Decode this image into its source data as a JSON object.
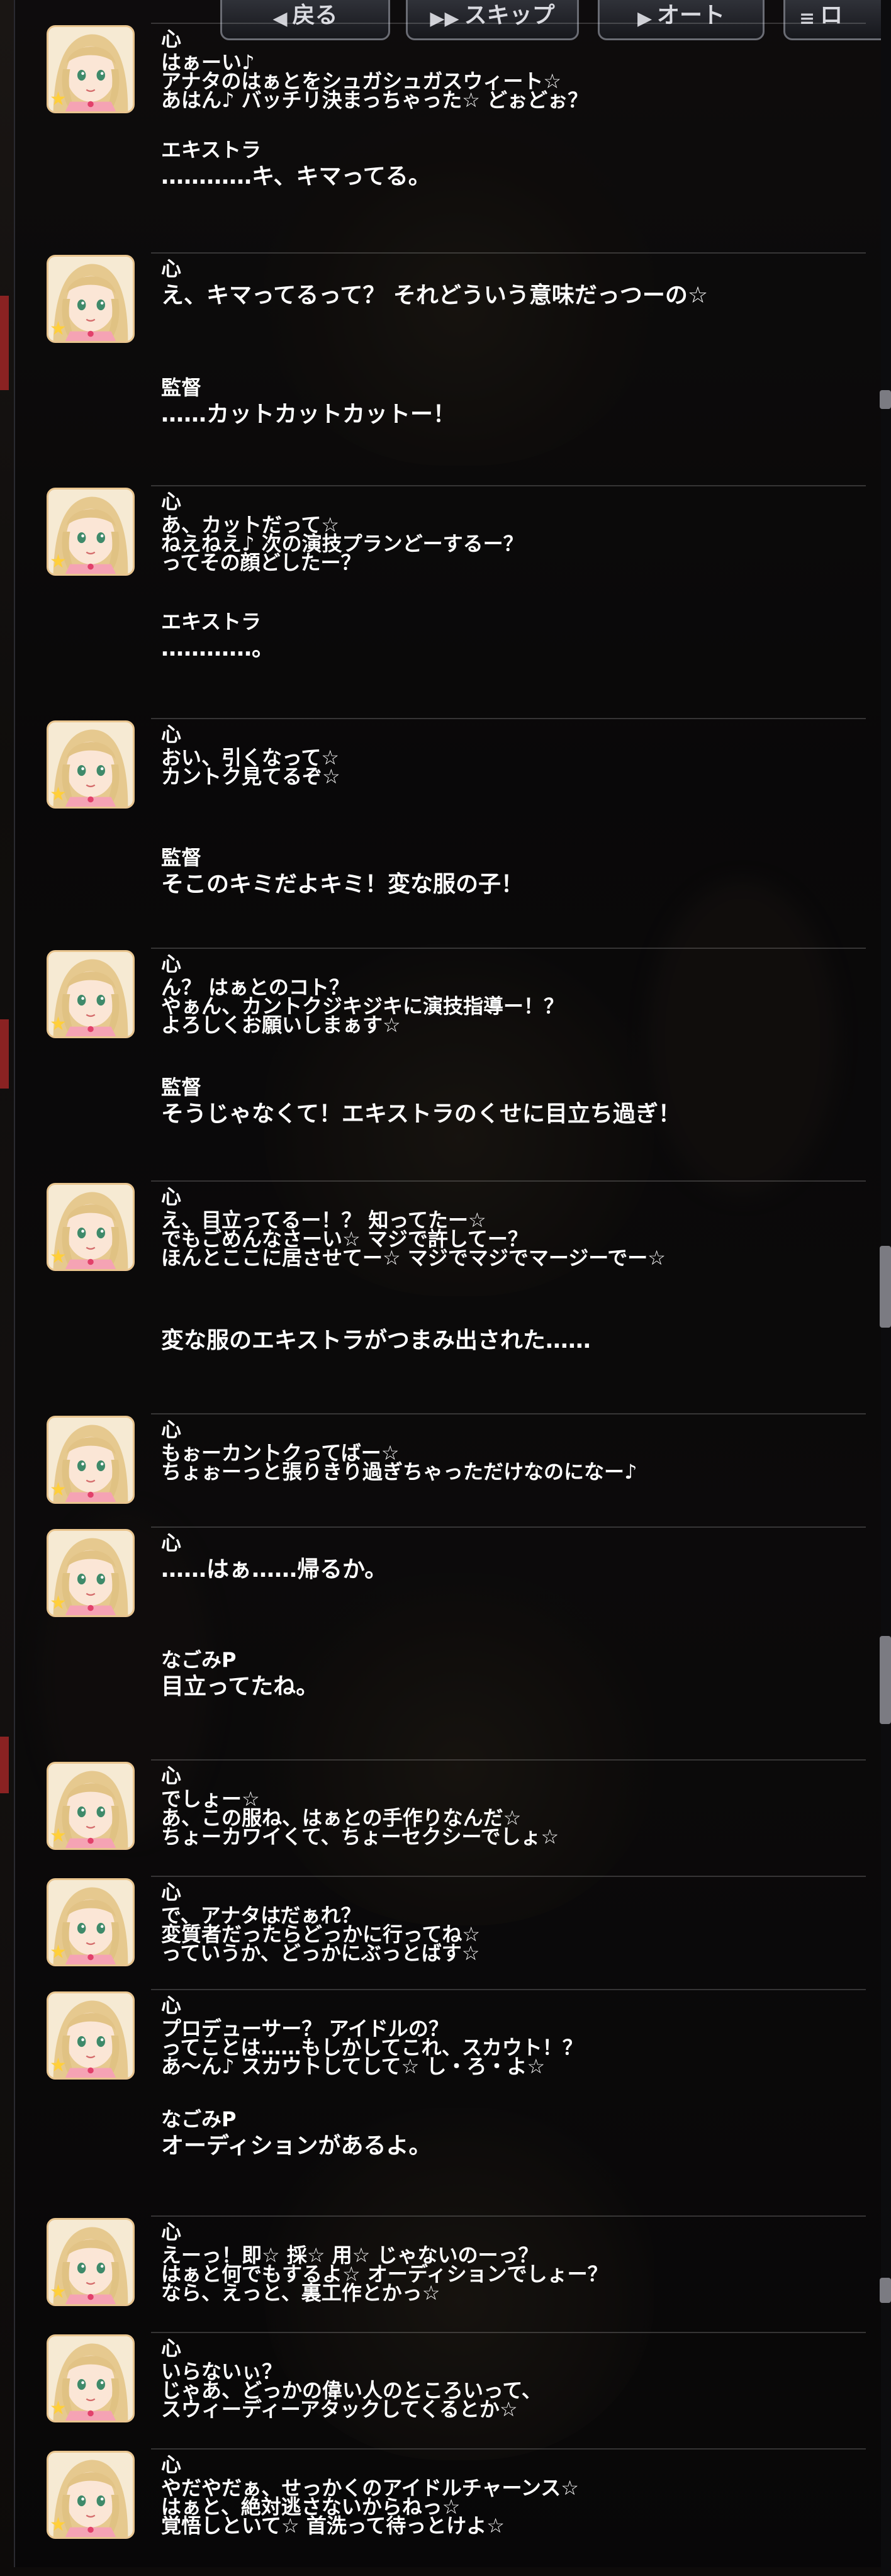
{
  "menu": {
    "buttons": [
      {
        "label": "戻る",
        "icon": "back-icon",
        "glyph": "◀"
      },
      {
        "label": "スキップ",
        "icon": "skip-icon",
        "glyph": "▶▶"
      },
      {
        "label": "オート",
        "icon": "auto-icon",
        "glyph": "▶"
      },
      {
        "label": "ロ",
        "icon": "menu-icon",
        "glyph": "≡"
      }
    ]
  },
  "colors": {
    "accent_avatar_border": "#e9c58f",
    "star": "#ffcf3a",
    "text": "#ffffff"
  },
  "log": [
    {
      "speaker": "心",
      "avatar": true,
      "lines": [
        "はぁーい♪",
        "アナタのはぁとをシュガシュガスウィート☆",
        "あはん♪ バッチリ決まっちゃった☆ どぉどぉ？"
      ]
    },
    {
      "speaker": "エキストラ",
      "avatar": false,
      "lines": [
        "…………キ、キマってる。"
      ]
    },
    {
      "speaker": "心",
      "avatar": true,
      "lines": [
        "え、キマってるって？ それどういう意味だっつーの☆"
      ]
    },
    {
      "speaker": "監督",
      "avatar": false,
      "lines": [
        "……カットカットカットー！"
      ]
    },
    {
      "speaker": "心",
      "avatar": true,
      "lines": [
        "あ、カットだって☆",
        "ねえねえ♪ 次の演技プランどーするー？",
        "ってその顔どしたー？"
      ]
    },
    {
      "speaker": "エキストラ",
      "avatar": false,
      "lines": [
        "…………。"
      ]
    },
    {
      "speaker": "心",
      "avatar": true,
      "lines": [
        "おい、引くなって☆",
        "カントク見てるぞ☆"
      ]
    },
    {
      "speaker": "監督",
      "avatar": false,
      "lines": [
        "そこのキミだよキミ！変な服の子！"
      ]
    },
    {
      "speaker": "心",
      "avatar": true,
      "lines": [
        "ん？ はぁとのコト？",
        "やぁん、カントクジキジキに演技指導ー！？",
        "よろしくお願いしまぁす☆"
      ]
    },
    {
      "speaker": "監督",
      "avatar": false,
      "lines": [
        "そうじゃなくて！エキストラのくせに目立ち過ぎ！"
      ]
    },
    {
      "speaker": "心",
      "avatar": true,
      "lines": [
        "え、目立ってるー！？ 知ってたー☆",
        "でもごめんなさーい☆ マジで許してー？",
        "ほんとここに居させてー☆ マジでマジでマージーでー☆"
      ]
    },
    {
      "speaker": "",
      "avatar": false,
      "lines": [
        "変な服のエキストラがつまみ出された……"
      ]
    },
    {
      "speaker": "心",
      "avatar": true,
      "lines": [
        "もぉーカントクってばー☆",
        "ちょぉーっと張りきり過ぎちゃっただけなのになー♪"
      ]
    },
    {
      "speaker": "心",
      "avatar": true,
      "lines": [
        "……はぁ……帰るか。"
      ]
    },
    {
      "speaker": "なごみP",
      "avatar": false,
      "lines": [
        "目立ってたね。"
      ]
    },
    {
      "speaker": "心",
      "avatar": true,
      "lines": [
        "でしょー☆",
        "あ、この服ね、はぁとの手作りなんだ☆",
        "ちょーカワイくて、ちょーセクシーでしょ☆"
      ]
    },
    {
      "speaker": "心",
      "avatar": true,
      "lines": [
        "で、アナタはだぁれ？",
        "変質者だったらどっかに行ってね☆",
        "っていうか、どっかにぶっとばす☆"
      ]
    },
    {
      "speaker": "心",
      "avatar": true,
      "lines": [
        "プロデューサー？ アイドルの？",
        "ってことは……もしかしてこれ、スカウト！？",
        "あ～ん♪ スカウトしてして☆ し・ろ・よ☆"
      ]
    },
    {
      "speaker": "なごみP",
      "avatar": false,
      "lines": [
        "オーディションがあるよ。"
      ]
    },
    {
      "speaker": "心",
      "avatar": true,
      "lines": [
        "えーっ！即☆ 採☆ 用☆ じゃないのーっ？",
        "はぁと何でもするよ☆ オーディションでしょー？",
        "なら、えっと、裏工作とかっ☆"
      ]
    },
    {
      "speaker": "心",
      "avatar": true,
      "lines": [
        "いらないぃ？",
        "じゃあ、どっかの偉い人のところいって、",
        "スウィーディーアタックしてくるとか☆"
      ]
    },
    {
      "speaker": "心",
      "avatar": true,
      "lines": [
        "やだやだぁ、せっかくのアイドルチャーンス☆",
        "はぁと、絶対逃さないからねっ☆",
        "覚悟しといて☆ 首洗って待っとけよ☆"
      ]
    }
  ]
}
